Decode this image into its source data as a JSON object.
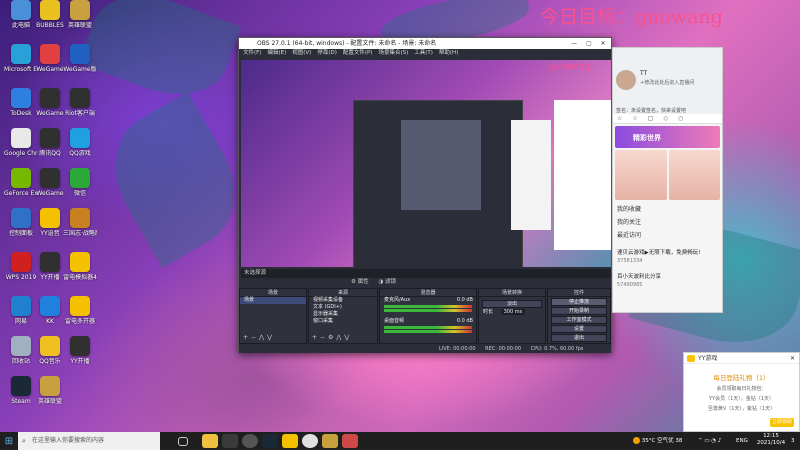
{
  "desktop": {
    "watermark": "今日目标：guowang",
    "icons": [
      {
        "label": "此电脑",
        "color": "#4a90d9"
      },
      {
        "label": "BUBBLES",
        "color": "#e8c020"
      },
      {
        "label": "英雄联盟",
        "color": "#c8a040"
      },
      {
        "label": "Microsoft Edge",
        "color": "#2aa0d8"
      },
      {
        "label": "WeGame",
        "color": "#e04040"
      },
      {
        "label": "WeGame版",
        "color": "#2060c0"
      },
      {
        "label": "ToDesk",
        "color": "#2f7fe0"
      },
      {
        "label": "WeGame",
        "color": "#303030"
      },
      {
        "label": "Riot客户端",
        "color": "#303030"
      },
      {
        "label": "Google Chrome",
        "color": "#e8e8e8"
      },
      {
        "label": "腾讯QQ",
        "color": "#303030"
      },
      {
        "label": "QQ游戏",
        "color": "#20a0e0"
      },
      {
        "label": "GeForce Experience",
        "color": "#76b900"
      },
      {
        "label": "WeGame",
        "color": "#303030"
      },
      {
        "label": "微信",
        "color": "#2aa838"
      },
      {
        "label": "控制面板",
        "color": "#3070c8"
      },
      {
        "label": "YY语音",
        "color": "#f4c000"
      },
      {
        "label": "三国志·战略版",
        "color": "#c88020"
      },
      {
        "label": "WPS 2019",
        "color": "#d02020"
      },
      {
        "label": "YY开播",
        "color": "#303030"
      },
      {
        "label": "雷电模拟器4",
        "color": "#f4c000"
      },
      {
        "label": "网易",
        "color": "#2080d0"
      },
      {
        "label": "KK",
        "color": "#2080e0"
      },
      {
        "label": "雷电多开器",
        "color": "#f4c000"
      },
      {
        "label": "回收站",
        "color": "#a0b0c0"
      },
      {
        "label": "QQ音乐",
        "color": "#f0c020"
      },
      {
        "label": "YY开播",
        "color": "#303030"
      },
      {
        "label": "Steam",
        "color": "#1b2838"
      },
      {
        "label": "英雄联盟",
        "color": "#c8a040"
      }
    ]
  },
  "obs": {
    "title": "OBS 27.0.1 (64-bit, windows) - 配置文件: 未命名 - 场景: 未命名",
    "menu": [
      "文件(F)",
      "编辑(E)",
      "视图(V)",
      "停靠(D)",
      "配置文件(P)",
      "场景集合(S)",
      "工具(T)",
      "帮助(H)"
    ],
    "preview_watermark": "guowang",
    "source_bar": "未选择源",
    "dock_bar_items": [
      "属性",
      "滤镜"
    ],
    "scenes": {
      "header": "场景",
      "items": [
        "场景"
      ]
    },
    "sources": {
      "header": "来源",
      "items": [
        "视频采集设备",
        "文本 (GDI+)",
        "显示器采集",
        "窗口采集"
      ]
    },
    "mixer": {
      "header": "混音器",
      "channels": [
        {
          "name": "麦克风/Aux",
          "db": "0.0 dB"
        },
        {
          "name": "桌面音频",
          "db": "0.0 dB"
        }
      ]
    },
    "transitions": {
      "header": "场景转换",
      "type": "淡出",
      "duration_label": "时长",
      "duration": "300 ms"
    },
    "controls": {
      "header": "控件",
      "buttons": [
        "停止推流",
        "开始录制",
        "工作室模式",
        "设置",
        "退出"
      ]
    },
    "status": {
      "live": "LIVE: 00:00:00",
      "rec": "REC: 00:00:00",
      "cpu": "CPU: 0.7%, 60.00 fps"
    }
  },
  "chat": {
    "username": "TT",
    "subtitle": "+修改此处后进入直播间",
    "signature": "签名：未设置签名，快来设置吧",
    "tabs": [
      "☆",
      "☆",
      "▢",
      "◇",
      "○"
    ],
    "banner": "精彩世界",
    "entries": [
      "我的收藏",
      "我的关注",
      "最近访问"
    ],
    "rooms": [
      {
        "title": "速贝云游戏▶无限下载，免费畅玩!",
        "meta": "37581334"
      },
      {
        "title": "百小天波利比分享",
        "meta": "57490985"
      }
    ]
  },
  "yy_popup": {
    "app": "YY游戏",
    "title": "每日登陆礼物（1）",
    "lines": [
      "会员领取每日礼物包：",
      "YY会员（1天），金钻（1天）",
      "至尊黄V（1天），紫钻（1天）"
    ],
    "button": "立即领取"
  },
  "gift_badge": "登录",
  "taskbar": {
    "search_placeholder": "在这里输入你要搜索的内容",
    "weather": "35°C 空气优 38",
    "lang": "ENG",
    "time": "12:15",
    "date": "2021/10/4",
    "notif": "3"
  }
}
